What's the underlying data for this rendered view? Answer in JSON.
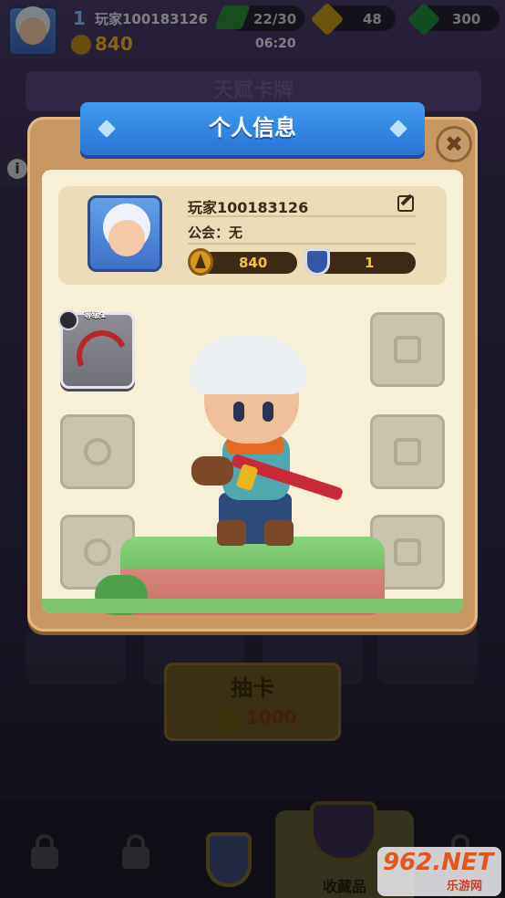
{
  "hud": {
    "level": "1",
    "player_name": "玩家100183126",
    "trophies": "840",
    "energy": "22/30",
    "timer": "06:20",
    "coins": "48",
    "gems": "300"
  },
  "background": {
    "screen_title": "天赋卡牌",
    "draw_button_label": "抽卡",
    "draw_cost": "1000",
    "nav_selected_label": "收藏品"
  },
  "dialog": {
    "title": "个人信息",
    "close_icon": "close-icon",
    "player_name": "玩家100183126",
    "guild": "公会：无",
    "trophies": "840",
    "rank": "1",
    "bow_level": "等级1"
  },
  "watermark": {
    "logo": "962.NET",
    "sub": "乐游网"
  },
  "colors": {
    "banner_blue": "#2a74d4",
    "panel_wood": "#c99862",
    "parchment": "#f7efd6",
    "stat_text": "#f0c24a"
  }
}
